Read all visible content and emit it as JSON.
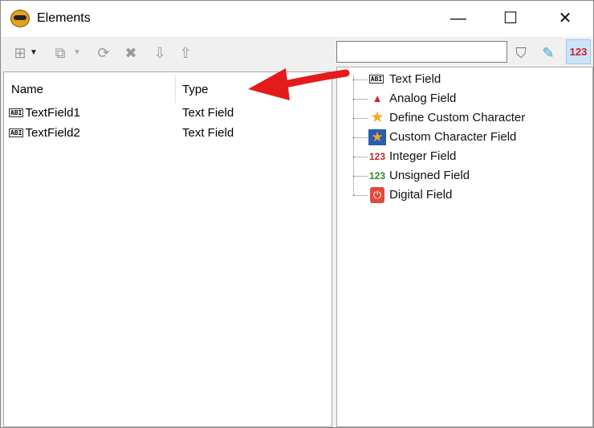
{
  "window": {
    "title": "Elements",
    "minimize": "—",
    "maximize": "☐",
    "close": "✕"
  },
  "toolbar": {
    "search_value": "",
    "buttons": [
      "add-element",
      "move-element",
      "refresh-element",
      "delete-element",
      "move-down",
      "move-up"
    ],
    "right_buttons": [
      "filter",
      "tag-edit",
      "numeric-view"
    ],
    "numeric_label": "123"
  },
  "list": {
    "columns": [
      "Name",
      "Type"
    ],
    "rows": [
      {
        "name": "TextField1",
        "type": "Text Field"
      },
      {
        "name": "TextField2",
        "type": "Text Field"
      }
    ],
    "icon_text": "ABI"
  },
  "tree": {
    "items": [
      {
        "label": "Text Field",
        "icon": "text-field-icon"
      },
      {
        "label": "Analog Field",
        "icon": "analog-field-icon"
      },
      {
        "label": "Define Custom Character",
        "icon": "star-icon"
      },
      {
        "label": "Custom Character Field",
        "icon": "custom-star-icon"
      },
      {
        "label": "Integer Field",
        "icon": "integer-icon"
      },
      {
        "label": "Unsigned Field",
        "icon": "unsigned-icon"
      },
      {
        "label": "Digital Field",
        "icon": "digital-icon"
      }
    ]
  },
  "colors": {
    "arrow": "#e31b1b",
    "selected_button": "#cce4f7"
  }
}
